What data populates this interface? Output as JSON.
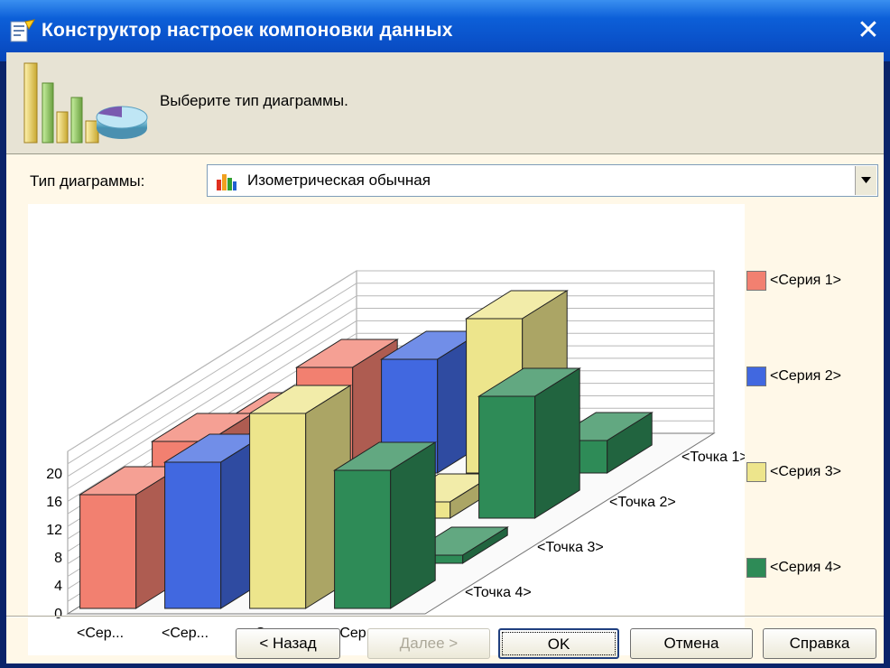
{
  "window": {
    "title": "Конструктор настроек компоновки данных",
    "close_symbol": "✕"
  },
  "header": {
    "instruction": "Выберите тип диаграммы."
  },
  "chart_type": {
    "label": "Тип диаграммы:",
    "value": "Изометрическая обычная",
    "icon": "chart-icon"
  },
  "buttons": {
    "back": "< Назад",
    "next": "Далее >",
    "ok": "OK",
    "cancel": "Отмена",
    "help": "Справка"
  },
  "chart_data": {
    "type": "bar",
    "subtype": "3d-isometric",
    "categories": [
      "<Сер...",
      "<Сер...",
      "<Сер...",
      "<Сер..."
    ],
    "points": [
      "<Точка 1>",
      "<Точка 2>",
      "<Точка 3>",
      "<Точка 4>"
    ],
    "yticks": [
      "0",
      "4",
      "8",
      "12",
      "16",
      "20"
    ],
    "ylim": [
      0,
      20
    ],
    "series": [
      {
        "name": "<Серия 1>",
        "color": "#f28070",
        "values": [
          14,
          15,
          12,
          13
        ]
      },
      {
        "name": "<Серия 2>",
        "color": "#4168e0",
        "values": [
          18,
          15,
          2,
          14
        ]
      },
      {
        "name": "<Серия 3>",
        "color": "#ede58c",
        "values": [
          24,
          1,
          2,
          19
        ]
      },
      {
        "name": "<Серия 4>",
        "color": "#2e8b57",
        "values": [
          17,
          1,
          15,
          4
        ]
      }
    ],
    "legend_position": "right",
    "grid": true
  }
}
